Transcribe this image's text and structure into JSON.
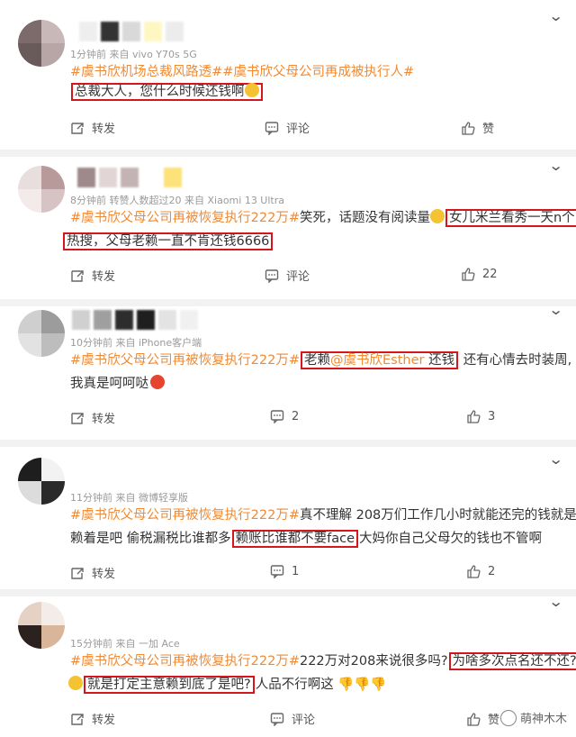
{
  "comments": [
    {
      "meta": "1分钟前  来自 vivo Y70s 5G",
      "tags": "#虞书欣机场总裁风路透##虞书欣父母公司再成被执行人#",
      "text_boxed": "总裁大人，您什么时候还钱啊",
      "actions": {
        "repost": "转发",
        "comment": "评论",
        "like": "赞"
      }
    },
    {
      "meta": "8分钟前  转赞人数超过20  来自 Xiaomi 13 Ultra",
      "tag": "#虞书欣父母公司再被恢复执行222万#",
      "text_a": "笑死，话题没有阅读量",
      "text_boxed_a": "女儿米兰看秀一天n个",
      "text_boxed_b": "热搜，父母老赖一直不肯还钱6666",
      "actions": {
        "repost": "转发",
        "comment": "评论",
        "like": "22"
      }
    },
    {
      "meta": "10分钟前  来自 iPhone客户端",
      "tag": "#虞书欣父母公司再被恢复执行222万#",
      "boxed_pre": "老赖",
      "boxed_mention": "@虞书欣Esther",
      "boxed_post": " 还钱",
      "text_after": "还有心情去时装周,",
      "text_line2": "我真是呵呵哒",
      "actions": {
        "repost": "转发",
        "comment": "2",
        "like": "3"
      }
    },
    {
      "meta": "11分钟前  来自 微博轻享版",
      "tag": "#虞书欣父母公司再被恢复执行222万#",
      "text_a": "真不理解 208万们工作几小时就能还完的钱就是",
      "text_b1": "赖着是吧 偷税漏税比谁都多",
      "text_boxed": "赖账比谁都不要face",
      "text_b2": "大妈你自己父母欠的钱也不管啊",
      "actions": {
        "repost": "转发",
        "comment": "1",
        "like": "2"
      }
    },
    {
      "meta": "15分钟前  来自 一加 Ace",
      "tag": "#虞书欣父母公司再被恢复执行222万#",
      "text_a": "222万对208来说很多吗?",
      "text_boxed_a": "为啥多次点名还不还?",
      "text_boxed_b": "就是打定主意赖到底了是吧?",
      "text_b2": "人品不行啊这",
      "actions": {
        "repost": "转发",
        "comment": "评论",
        "like": "赞"
      }
    }
  ],
  "watermark": "萌神木木",
  "colors": {
    "tag": "#f18a32",
    "highlight_box": "#d6161e",
    "separator": "#f2f2f2"
  },
  "icons": [
    "repost-icon",
    "comment-icon",
    "like-icon",
    "chevron-down-icon"
  ]
}
